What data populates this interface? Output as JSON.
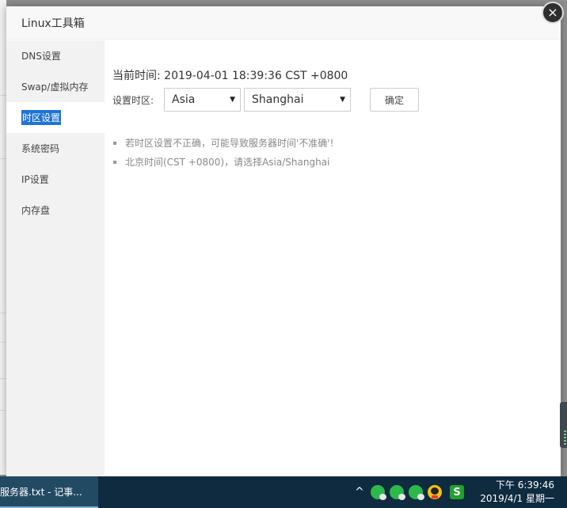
{
  "modal": {
    "title": "Linux工具箱",
    "close_icon": "×"
  },
  "sidebar": {
    "items": [
      {
        "label": "DNS设置",
        "active": false
      },
      {
        "label": "Swap/虚拟内存",
        "active": false
      },
      {
        "label": "时区设置",
        "active": true
      },
      {
        "label": "系统密码",
        "active": false
      },
      {
        "label": "IP设置",
        "active": false
      },
      {
        "label": "内存盘",
        "active": false
      }
    ]
  },
  "timezone": {
    "current_time_label": "当前时间: 2019-04-01 18:39:36 CST +0800",
    "set_label": "设置时区:",
    "region_value": "Asia",
    "city_value": "Shanghai",
    "confirm_label": "确定",
    "notes": [
      "若时区设置不正确，可能导致服务器时间'不准确'!",
      "北京时间(CST +0800)，请选择Asia/Shanghai"
    ]
  },
  "taskbar": {
    "task_label": "服务器.txt - 记事...",
    "tray_chevron": "^",
    "tray_icons": [
      "wechat-icon",
      "wechat-icon",
      "wechat-icon",
      "qq-icon",
      "s-icon"
    ],
    "s_label": "S",
    "time": "下午 6:39:46",
    "date": "2019/4/1 星期一"
  },
  "colors": {
    "accent": "#1e74d8",
    "taskbar": "#0f2b40",
    "sidebar_bg": "#f2f2f2"
  }
}
